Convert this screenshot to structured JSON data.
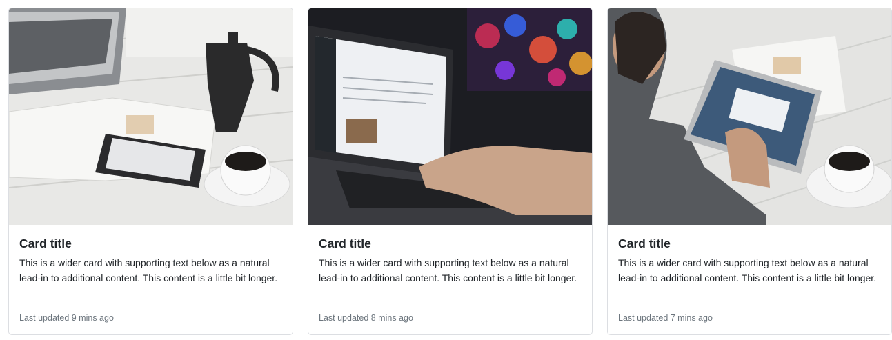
{
  "cards": [
    {
      "image": "coffee-desk-tablet-photo",
      "title": "Card title",
      "text": "This is a wider card with supporting text below as a natural lead-in to additional content. This content is a little bit longer.",
      "updated": "Last updated 9 mins ago"
    },
    {
      "image": "laptop-typing-photo",
      "title": "Card title",
      "text": "This is a wider card with supporting text below as a natural lead-in to additional content. This content is a little bit longer.",
      "updated": "Last updated 8 mins ago"
    },
    {
      "image": "man-using-tablet-photo",
      "title": "Card title",
      "text": "This is a wider card with supporting text below as a natural lead-in to additional content. This content is a little bit longer.",
      "updated": "Last updated 7 mins ago"
    }
  ],
  "colors": {
    "border": "#dcdee2",
    "title": "#212529",
    "muted": "#6c757d"
  }
}
